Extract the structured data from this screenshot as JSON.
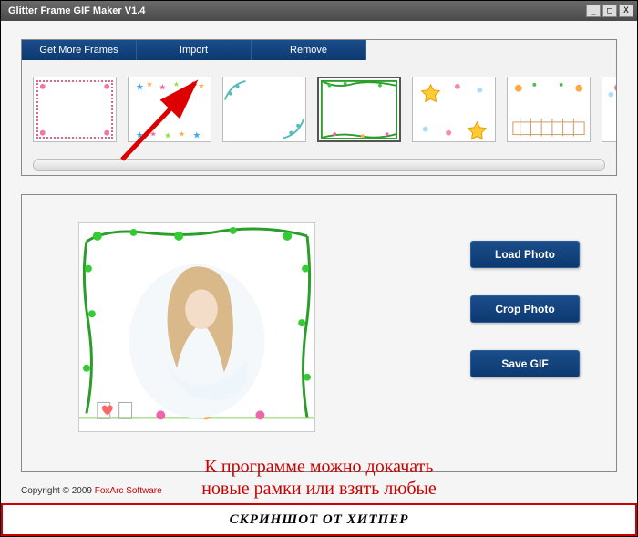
{
  "window": {
    "title": "Glitter Frame GIF Maker V1.4"
  },
  "titlebar_controls": {
    "min": "_",
    "max": "□",
    "close": "X"
  },
  "frames_toolbar": {
    "get_more": "Get More Frames",
    "import": "Import",
    "remove": "Remove"
  },
  "side_buttons": {
    "load_photo": "Load Photo",
    "crop_photo": "Crop Photo",
    "save_gif": "Save GIF"
  },
  "footer": {
    "copyright": "Copyright © 2009 ",
    "vendor": "FoxArc Software"
  },
  "annotations": {
    "line1": "К программе можно докачать",
    "line2": "новые рамки или взять любые",
    "watermark": "СКРИНШОТ ОТ ХИТПЕР"
  },
  "thumbs": [
    {
      "id": "frame-pink-dots",
      "selected": false
    },
    {
      "id": "frame-stars-blue",
      "selected": false
    },
    {
      "id": "frame-corner-flowers",
      "selected": false
    },
    {
      "id": "frame-green-vine",
      "selected": true
    },
    {
      "id": "frame-yellow-stars",
      "selected": false
    },
    {
      "id": "frame-fence-garden",
      "selected": false
    },
    {
      "id": "frame-corner-pink",
      "selected": false
    }
  ]
}
